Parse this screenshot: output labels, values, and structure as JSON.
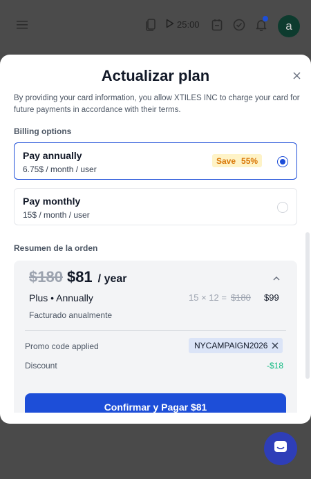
{
  "appbar": {
    "timer_value": "25:00",
    "avatar_initial": "a"
  },
  "modal": {
    "title": "Actualizar plan",
    "disclaimer": "By providing your card information, you allow XTILES INC to charge your card for future payments in accordance with their terms.",
    "billing_label": "Billing options",
    "options": [
      {
        "title": "Pay annually",
        "subtitle": "6.75$ / month / user",
        "badge_label": "Save",
        "badge_value": "55%",
        "selected": true
      },
      {
        "title": "Pay monthly",
        "subtitle": "15$ / month / user",
        "selected": false
      }
    ],
    "summary_label": "Resumen de la orden",
    "summary": {
      "old_price": "$180",
      "new_price": "$81",
      "period": "/ year",
      "plan_name": "Plus • Annually",
      "calc_formula": "15 × 12 =",
      "calc_old": "$180",
      "calc_total": "$99",
      "billed_text": "Facturado anualmente",
      "promo_label": "Promo code applied",
      "promo_code": "NYCAMPAIGN2026",
      "discount_label": "Discount",
      "discount_value": "-$18",
      "confirm_label": "Confirmar y Pagar $81"
    }
  },
  "colors": {
    "accent": "#1d4ed8",
    "badge_bg": "#fef3c7",
    "badge_text": "#d97706",
    "discount": "#10b981",
    "chat_bg": "#2e3eb8"
  }
}
